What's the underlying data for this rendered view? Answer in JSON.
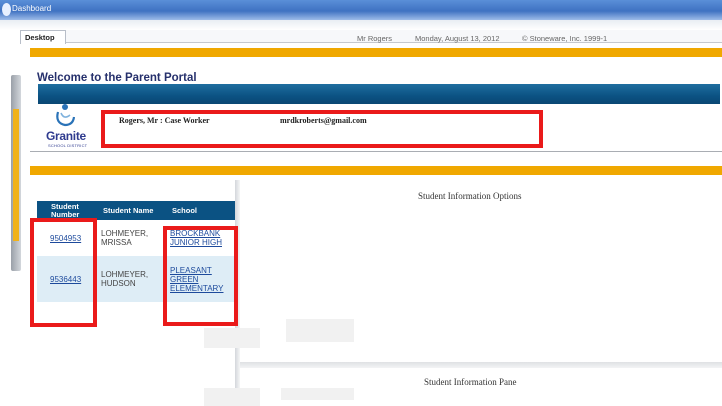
{
  "window": {
    "title": "Dashboard"
  },
  "tabs": [
    {
      "label": "Desktop"
    }
  ],
  "info": {
    "user": "Mr Rogers",
    "date": "Monday, August 13, 2012",
    "copyright": "© Stoneware, Inc. 1999-1"
  },
  "portal": {
    "title": "Welcome to the Parent Portal",
    "logo_text": "Granite",
    "logo_subtext": "SCHOOL DISTRICT",
    "user_name": "Rogers, Mr : Case Worker",
    "user_email": "mrdkroberts@gmail.com"
  },
  "students": {
    "columns": [
      "Student Number",
      "Student Name",
      "School"
    ],
    "rows": [
      {
        "number": "9504953",
        "name": "LOHMEYER, MRISSA",
        "school": "BROCKBANK JUNIOR HIGH"
      },
      {
        "number": "9536443",
        "name": "LOHMEYER, HUDSON",
        "school": "PLEASANT GREEN ELEMENTARY"
      }
    ]
  },
  "panes": {
    "options_title": "Student Information Options",
    "info_title": "Student Information Pane"
  },
  "colors": {
    "accent_orange": "#f0a800",
    "header_blue": "#0b5283",
    "highlight_red": "#ea1a1a",
    "link_blue": "#1d4a9c"
  }
}
